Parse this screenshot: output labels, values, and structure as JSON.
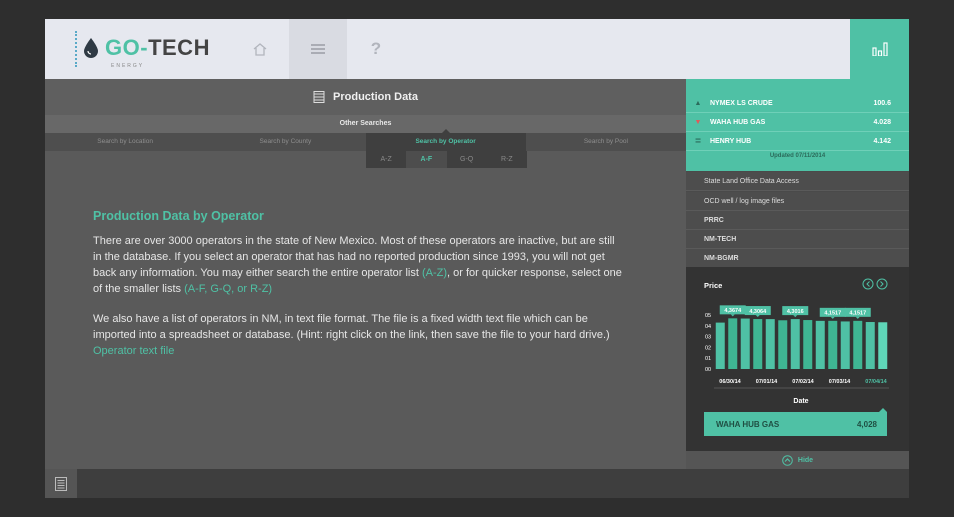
{
  "header": {
    "logo_go": "GO",
    "logo_tech": "TECH",
    "logo_sub": "ENERGY",
    "nav": {
      "home_icon": "home-icon",
      "menu_icon": "hamburger-menu-icon",
      "help_label": "?"
    }
  },
  "main": {
    "title": "Production Data",
    "other_searches": "Other Searches",
    "search_tabs": [
      "Search by Location",
      "Search by County",
      "Search by Operator",
      "Search by Pool"
    ],
    "letter_tabs": [
      "A-Z",
      "A-F",
      "G-Q",
      "R-Z"
    ],
    "heading": "Production Data by Operator",
    "p1_text": "There are over 3000 operators in the state of New Mexico. Most of these operators are inactive, but are still in the database. If you select an operator that has had no reported production since 1993, you will not get back any information. You may either search the entire operator list ",
    "p1_link1": "(A-Z)",
    "p1_mid": ", or for quicker response, select one of the smaller lists ",
    "p1_link2": "(A-F, G-Q, or R-Z)",
    "p2_text": "We also have a list of operators in NM, in text file format. The file is a fixed width text file which can be imported into a spreadsheet or database. (Hint: right click on the link, then save the file to your hard drive.) ",
    "p2_link": "Operator text file"
  },
  "ticker": {
    "rows": [
      {
        "dir": "up",
        "name": "NYMEX LS CRUDE",
        "value": "100.6"
      },
      {
        "dir": "down",
        "name": "WAHA HUB GAS",
        "value": "4.028"
      },
      {
        "dir": "flat",
        "name": "HENRY HUB",
        "value": "4.142"
      }
    ],
    "updated": "Updated 07/11/2014"
  },
  "sidebar_links": [
    "State Land Office Data Access",
    "OCD well / log image files",
    "PRRC",
    "NM-TECH",
    "NM-BGMR"
  ],
  "hide_label": "Hide",
  "colors": {
    "accent": "#4fc1a5"
  },
  "chart_data": {
    "type": "bar",
    "ylabel": "Price",
    "xlabel": "Date",
    "yticks": [
      "05",
      "04",
      "03",
      "02",
      "01",
      "00"
    ],
    "ylim": [
      0,
      5
    ],
    "x_tick_labels": [
      "06/30/14",
      "07/01/14",
      "07/02/14",
      "07/03/14",
      "07/04/14"
    ],
    "values": [
      4.0,
      4.3674,
      4.35,
      4.3064,
      4.3,
      4.2,
      4.3016,
      4.22,
      4.15,
      4.1517,
      4.1,
      4.1517,
      4.05,
      4.028
    ],
    "labels": [
      {
        "index": 1,
        "text": "4,3674"
      },
      {
        "index": 3,
        "text": "4,3064"
      },
      {
        "index": 6,
        "text": "4,3016"
      },
      {
        "index": 9,
        "text": "4,1517"
      },
      {
        "index": 11,
        "text": "4,1517"
      }
    ],
    "selected_series": "WAHA HUB GAS",
    "selected_value": "4,028"
  }
}
